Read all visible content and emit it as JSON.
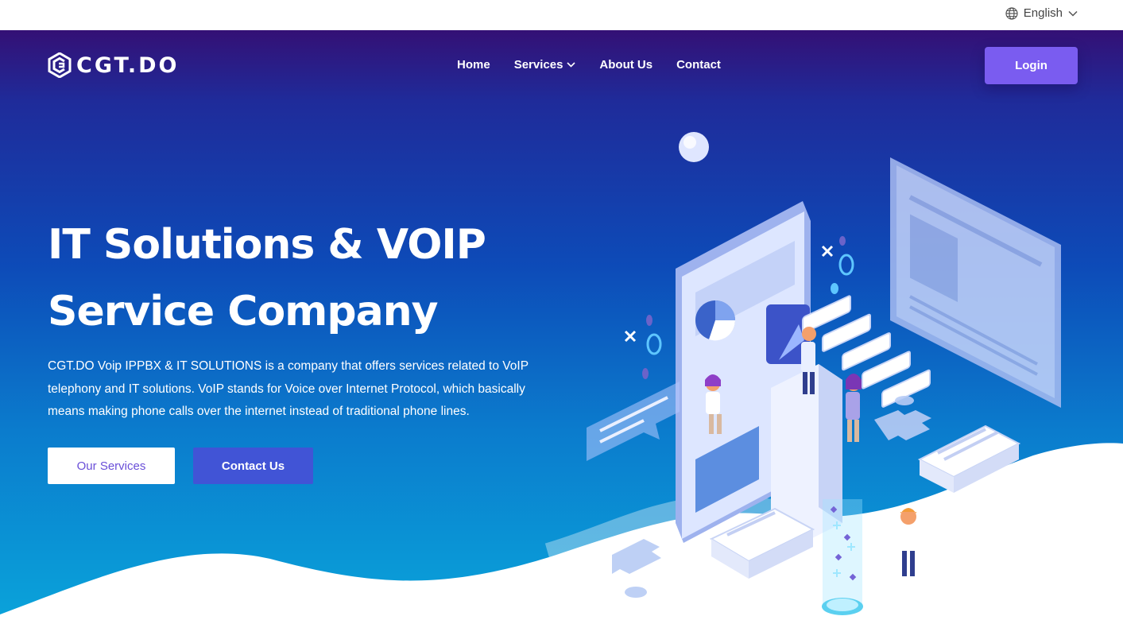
{
  "topbar": {
    "language": "English",
    "icons": [
      "globe-icon",
      "chevron-down-icon"
    ]
  },
  "brand": {
    "logo_text": "CGT.DO",
    "logo_icon": "cgt-logo-mark"
  },
  "nav": {
    "items": [
      {
        "label": "Home"
      },
      {
        "label": "Services",
        "has_dropdown": true
      },
      {
        "label": "About Us"
      },
      {
        "label": "Contact"
      }
    ],
    "login_label": "Login"
  },
  "hero": {
    "title_line1": "IT Solutions & VOIP",
    "title_line2": "Service Company",
    "description": "CGT.DO Voip IPPBX & IT SOLUTIONS is a company that offers services related to VoIP telephony and IT solutions. VoIP stands for Voice over Internet Protocol, which basically means making phone calls over the internet instead of traditional phone lines.",
    "primary_button": "Our Services",
    "secondary_button": "Contact Us"
  },
  "colors": {
    "hero_top": "#341075",
    "hero_mid": "#0d4bb8",
    "hero_bottom": "#0aa3da",
    "login_button": "#7a5cf0",
    "contact_button": "#4154d6",
    "services_text": "#6a4fd8"
  }
}
